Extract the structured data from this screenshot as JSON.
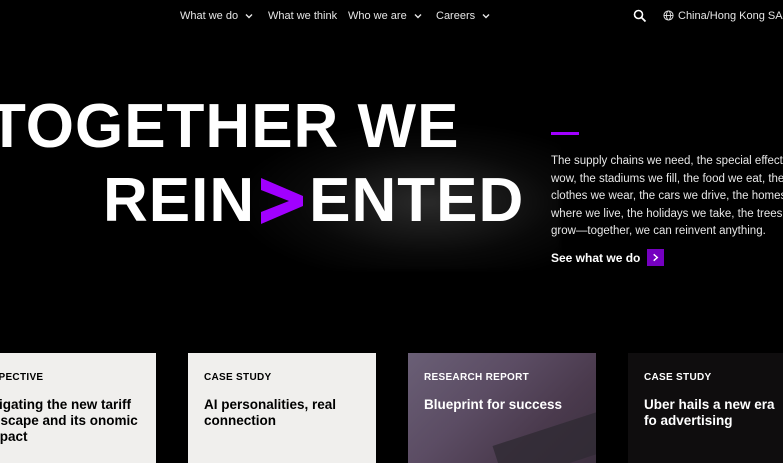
{
  "nav": {
    "items": [
      {
        "label": "What we do",
        "dropdown": true
      },
      {
        "label": "What we think",
        "dropdown": false
      },
      {
        "label": "Who we are",
        "dropdown": true
      },
      {
        "label": "Careers",
        "dropdown": true
      }
    ],
    "region": "China/Hong Kong SA"
  },
  "hero": {
    "line1": "TOGETHER WE",
    "line2_prefix": "REIN",
    "line2_suffix": "ENTED",
    "body": "The supply chains we need, the special effects that wow, the stadiums we fill, the food we eat, the clothes we wear, the cars we drive, the homes where we live, the holidays we take, the trees we grow—together, we can reinvent anything.",
    "cta": "See what we do"
  },
  "cards": [
    {
      "label": "RSPECTIVE",
      "title": "avigating the new tariff ndscape and its onomic impact"
    },
    {
      "label": "CASE STUDY",
      "title": "AI personalities, real connection"
    },
    {
      "label": "RESEARCH REPORT",
      "title": "Blueprint for success"
    },
    {
      "label": "CASE STUDY",
      "title": "Uber hails a new era fo advertising"
    }
  ],
  "colors": {
    "accent": "#a100ff",
    "cta_box": "#7500c0",
    "background": "#000000",
    "card_light": "#f0efed"
  }
}
